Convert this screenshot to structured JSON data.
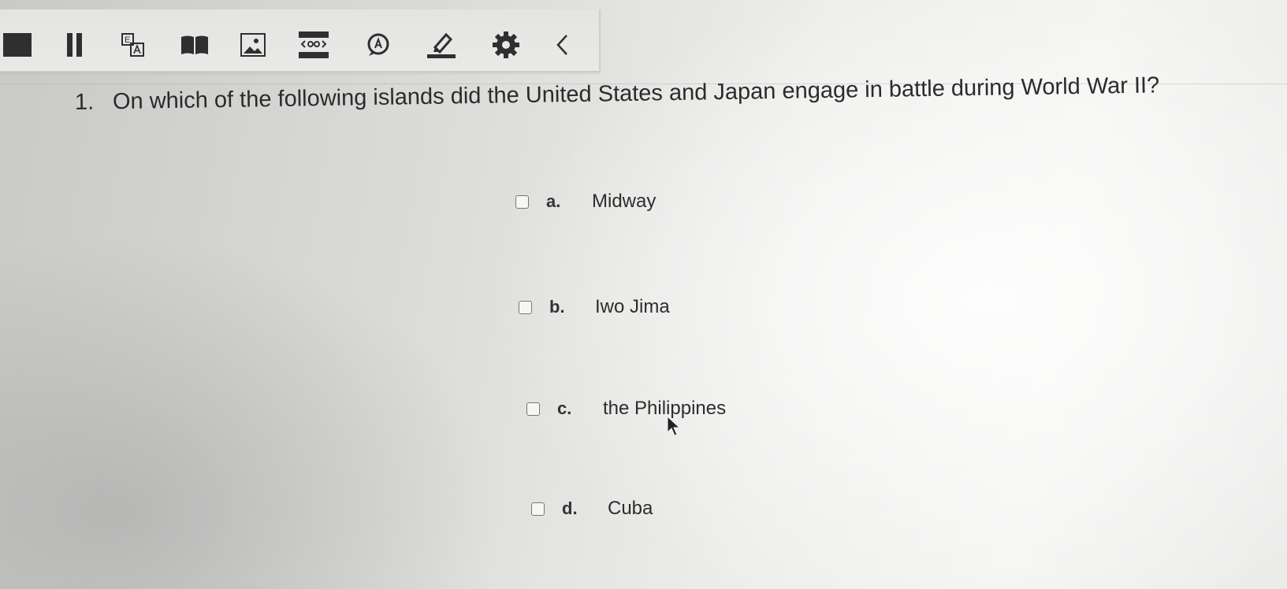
{
  "toolbar": {
    "tools": [
      {
        "name": "stop-icon"
      },
      {
        "name": "pause-icon"
      },
      {
        "name": "translate-icon"
      },
      {
        "name": "book-icon"
      },
      {
        "name": "image-icon"
      },
      {
        "name": "masking-icon"
      },
      {
        "name": "speech-bubble-icon"
      },
      {
        "name": "highlighter-icon"
      },
      {
        "name": "gear-icon"
      },
      {
        "name": "chevron-left-icon"
      }
    ]
  },
  "question": {
    "number": "1.",
    "text": "On which of the following islands did the United States and Japan engage in battle during World War II?"
  },
  "options": [
    {
      "letter": "a.",
      "text": "Midway",
      "checked": false
    },
    {
      "letter": "b.",
      "text": "Iwo Jima",
      "checked": false
    },
    {
      "letter": "c.",
      "text": "the Philippines",
      "checked": false
    },
    {
      "letter": "d.",
      "text": "Cuba",
      "checked": false
    }
  ],
  "colors": {
    "icon": "#2f2f2f",
    "text": "#2b2b2b",
    "toolbar_bg": "#e6e6e4"
  }
}
